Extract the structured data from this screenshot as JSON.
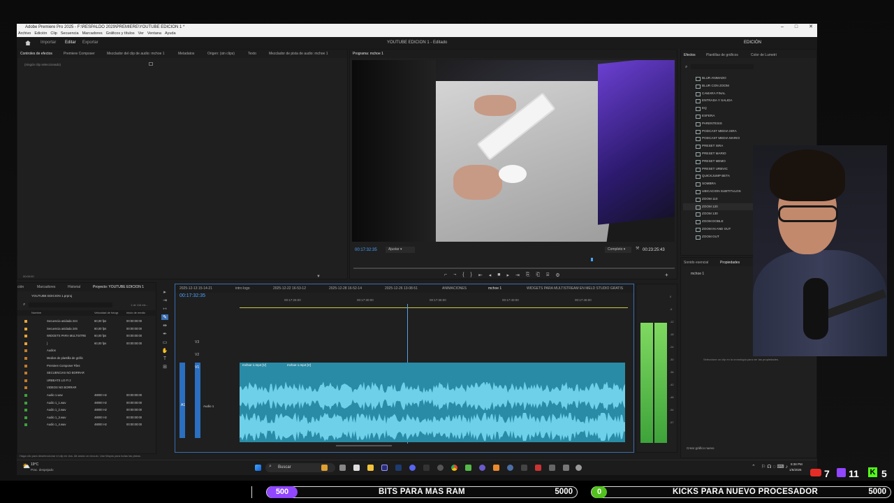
{
  "window": {
    "title": "Adobe Premiere Pro 2025 - F:\\RESPALDO 2029\\PREMIERE\\YOUTUBE EDICION 1 *",
    "menu": [
      "Archivo",
      "Edición",
      "Clip",
      "Secuencia",
      "Marcadores",
      "Gráficos y títulos",
      "Ver",
      "Ventana",
      "Ayuda"
    ],
    "workspace_tabs": [
      "Importar",
      "Editar",
      "Exportar"
    ],
    "project_status": "YOUTUBE EDICION 1 - Editado",
    "edition_label": "EDICIÓN"
  },
  "source_panel": {
    "tabs": [
      "Controles de efectos",
      "Premiere Composer",
      "Mezclador del clip de audio: mchoe 1",
      "Metadatos",
      "Origen: (sin clips)",
      "Texto",
      "Mezclador de pista de audio: mchoe 1"
    ],
    "empty_text": "(ningún clip seleccionado)",
    "timecode": "00:00:00"
  },
  "program_monitor": {
    "title": "Programa: mchoe 1",
    "timecode_current": "00:17:32:35",
    "fit": "Ajustar",
    "quality": "Completo",
    "timecode_total": "00:23:25:43"
  },
  "effects_panel": {
    "tabs": [
      "Efectos",
      "Plantillas de gráficos",
      "Color de Lumetri"
    ],
    "items": [
      "BLUR ANIMADO",
      "BLUR CON ZOOM",
      "CAMARA FINAL",
      "ENTRADA Y SALIDA",
      "EQ",
      "ESFERA",
      "PARENTESIS",
      "PODCAST MEDIA ISRA",
      "PODCAST MEDIA MARIO",
      "PRESET ISRA",
      "PRESET MARIO",
      "PRESET MEMO",
      "PRESET URBVIC",
      "QUICKJUMP BETA",
      "SOMBRA",
      "UBICACION SUBTITULOS",
      "ZOOM 110",
      "ZOOM 120",
      "ZOOM 130",
      "ZOOM DOBLE",
      "ZOOM IN AND OUT",
      "ZOOM OUT"
    ],
    "selected": "ZOOM 120"
  },
  "properties_panel": {
    "tabs": [
      "Sonido esencial",
      "Propiedades"
    ],
    "item": "mchoe 1",
    "hint": "Seleccione un clip en la cronología para ver las propiedades.",
    "create_button": "Crear gráfico nuevo"
  },
  "project_panel": {
    "tabs": [
      "ción",
      "Marcadores",
      "Historial",
      "Proyecto: YOUTUBE EDICION 1"
    ],
    "file": "YOUTUBE EDICION 1.prproj",
    "count": "1 de 116 ele...",
    "columns": [
      "Nombre",
      "Velocidad de fotogr.",
      "Inicio de medio"
    ],
    "rows": [
      {
        "name": "Secuencia anidada 244",
        "rate": "60,00 fps",
        "start": "00:00:00:00"
      },
      {
        "name": "Secuencia anidada 245",
        "rate": "60,00 fps",
        "start": "00:00:00:00"
      },
      {
        "name": "WIDGETS PARA MULTISTRE",
        "rate": "60,00 fps",
        "start": "00:00:00:00"
      },
      {
        "name": "}",
        "rate": "60,00 fps",
        "start": "00:00:00:00"
      },
      {
        "name": "Audios",
        "rate": "",
        "start": ""
      },
      {
        "name": "Medios de plantilla de gráfic",
        "rate": "",
        "start": ""
      },
      {
        "name": "Premiere Composer Files",
        "rate": "",
        "start": ""
      },
      {
        "name": "SECUENCIAS NO BORRAR",
        "rate": "",
        "start": ""
      },
      {
        "name": "URBEATS LO FI 2",
        "rate": "",
        "start": ""
      },
      {
        "name": "VIDEOS NO BORRAR",
        "rate": "",
        "start": ""
      },
      {
        "name": "Audio 1.wav",
        "rate": "48000 Hz",
        "start": "00:00:00:00"
      },
      {
        "name": "Audio 1_1.wav",
        "rate": "48000 Hz",
        "start": "00:00:00:00"
      },
      {
        "name": "Audio 1_2.wav",
        "rate": "48000 Hz",
        "start": "00:00:00:00"
      },
      {
        "name": "Audio 1_3.wav",
        "rate": "48000 Hz",
        "start": "00:00:00:00"
      },
      {
        "name": "Audio 1_4.wav",
        "rate": "48000 Hz",
        "start": "00:00:00:00"
      }
    ]
  },
  "timeline": {
    "tabs": [
      "2025-12-13 15-14-21",
      "intro logo",
      "2025-12-22 16-53-12",
      "2025-12-28 16-52-14",
      "2025-12-26 13-08-51",
      "ANIMACIONES",
      "mchoe 1",
      "WIDGETS PARA MULTISTREAM EN MELD STUDIO GRATIS"
    ],
    "timecode": "00:17:32:35",
    "ruler": [
      "00:17:25:00",
      "00:17:30:00",
      "00:17:35:00",
      "00:17:40:00",
      "00:17:45:00"
    ],
    "tracks": [
      "V3",
      "V2",
      "V1",
      "A1"
    ],
    "clip_name": "mchoe 1.mp4 [V]",
    "audio_label": "Audio 1"
  },
  "meter_scale": [
    "0",
    "-6",
    "-12",
    "-18",
    "-24",
    "-30",
    "-36",
    "-42",
    "-48",
    "-54",
    "-57"
  ],
  "status_bar": "Haga clic para deseleccionar el clip en dos. Alt anula un vínculo. Use Mayús para todas las pistas.",
  "taskbar": {
    "weather_temp": "19°C",
    "weather_desc": "Prac. despejado",
    "search": "Buscar",
    "time": "9:38 PM",
    "date": "1/6/2026"
  },
  "overlay": {
    "bits_goal": {
      "badge": "500",
      "label": "BITS PARA MAS RAM",
      "amount": "5000",
      "color": "#9146ff"
    },
    "kicks_goal": {
      "badge": "0",
      "label": "KICKS PARA NUEVO PROCESADOR",
      "amount": "5000",
      "color": "#53c11e"
    },
    "youtube_count": "7",
    "twitch_count": "11",
    "kick_count": "5"
  }
}
